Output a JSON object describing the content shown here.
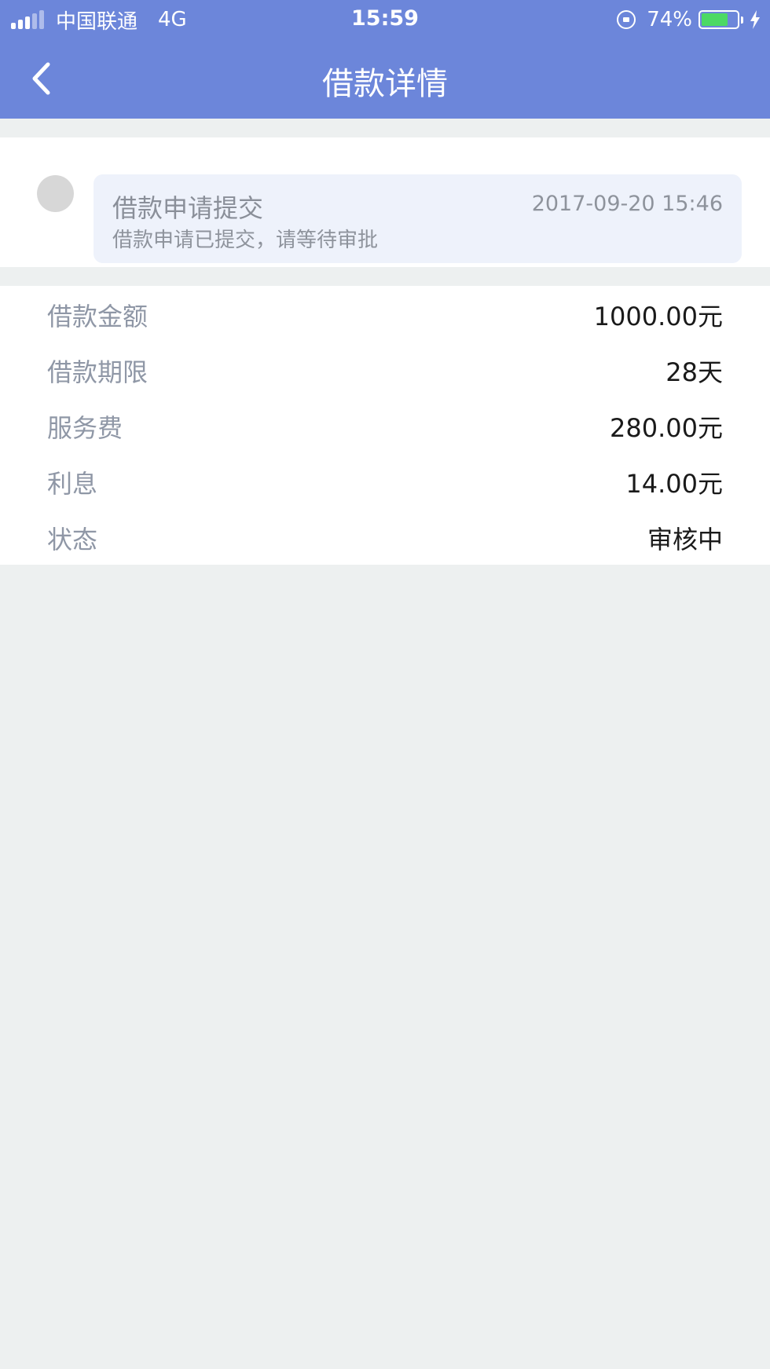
{
  "status_bar": {
    "carrier": "中国联通",
    "network": "4G",
    "time": "15:59",
    "battery_percent": "74%",
    "battery_level": 0.74,
    "battery_color": "#4cd964"
  },
  "nav": {
    "title": "借款详情",
    "back_icon": "chevron-left-icon",
    "background_color": "#6c86da"
  },
  "timeline": {
    "events": [
      {
        "title": "借款申请提交",
        "time": "2017-09-20 15:46",
        "description": "借款申请已提交，请等待审批"
      }
    ]
  },
  "details": {
    "rows": [
      {
        "label": "借款金额",
        "value": "1000.00元"
      },
      {
        "label": "借款期限",
        "value": "28天"
      },
      {
        "label": "服务费",
        "value": "280.00元"
      },
      {
        "label": "利息",
        "value": "14.00元"
      },
      {
        "label": "状态",
        "value": "审核中"
      }
    ]
  }
}
